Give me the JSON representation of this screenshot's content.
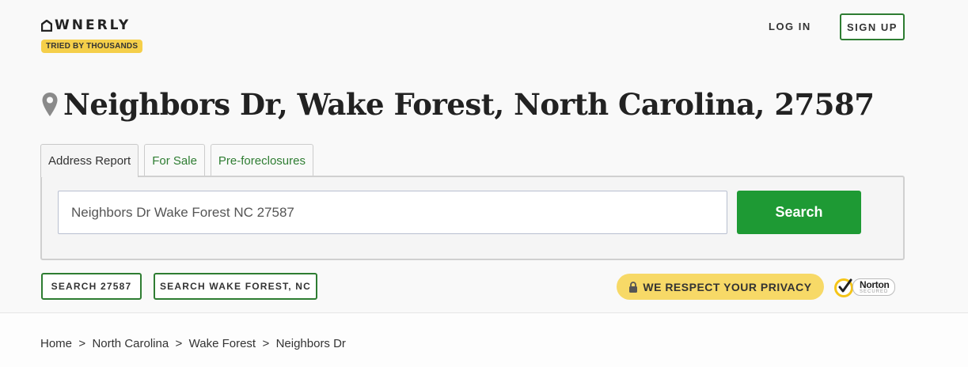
{
  "brand": {
    "name": "WNERLY",
    "tagline": "TRIED BY THOUSANDS"
  },
  "nav": {
    "login_label": "LOG IN",
    "signup_label": "SIGN UP"
  },
  "page": {
    "title": "Neighbors Dr, Wake Forest, North Carolina, 27587"
  },
  "tabs": [
    {
      "label": "Address Report",
      "active": true
    },
    {
      "label": "For Sale",
      "active": false
    },
    {
      "label": "Pre-foreclosures",
      "active": false
    }
  ],
  "search": {
    "value": "Neighbors Dr Wake Forest NC 27587",
    "button_label": "Search"
  },
  "quick_links": [
    {
      "label": "SEARCH 27587"
    },
    {
      "label": "SEARCH WAKE FOREST, NC"
    }
  ],
  "privacy": {
    "label": "WE RESPECT YOUR PRIVACY"
  },
  "norton": {
    "name": "Norton",
    "sub": "SECURED"
  },
  "breadcrumb": {
    "items": [
      "Home",
      "North Carolina",
      "Wake Forest",
      "Neighbors Dr"
    ],
    "separator": ">"
  },
  "colors": {
    "accent_green": "#1e9a34",
    "border_green": "#2e7d32",
    "badge_yellow": "#f5cf4a",
    "privacy_yellow": "#f7d967"
  },
  "icons": {
    "logo": "house-o-icon",
    "pin": "location-pin-icon",
    "lock": "lock-icon",
    "norton": "norton-checkmark-icon"
  }
}
